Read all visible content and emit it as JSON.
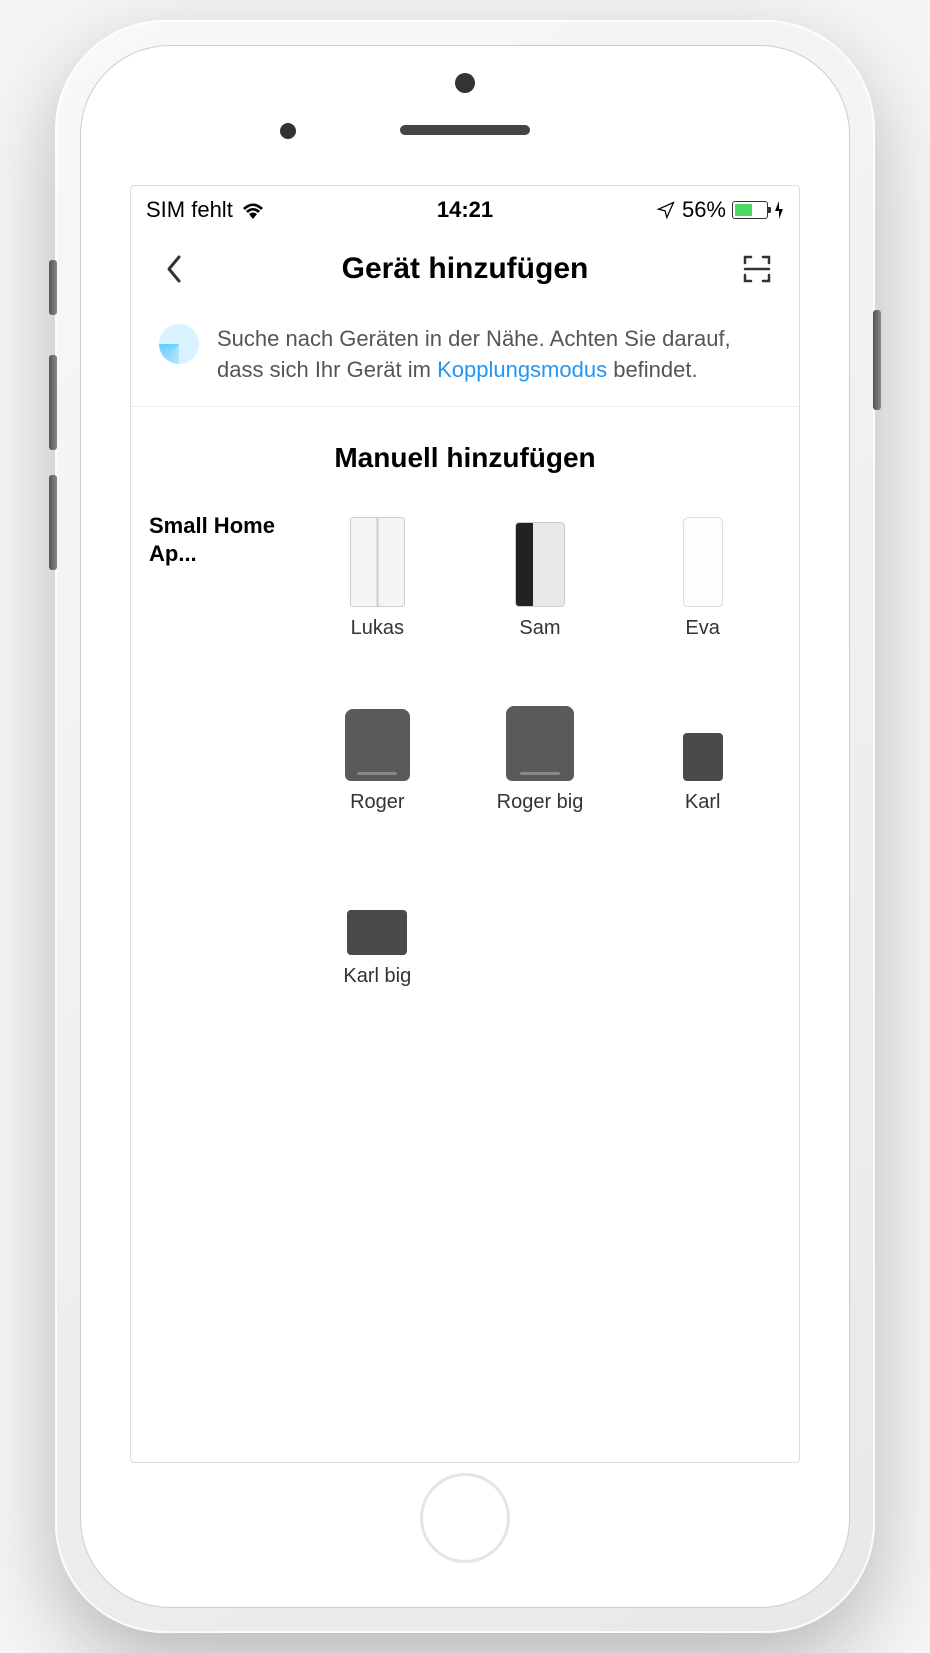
{
  "statusBar": {
    "carrier": "SIM fehlt",
    "time": "14:21",
    "batteryPercent": "56%"
  },
  "header": {
    "title": "Gerät hinzufügen"
  },
  "searchInfo": {
    "textBefore": "Suche nach Geräten in der Nähe. Achten Sie darauf, dass sich Ihr Gerät im ",
    "linkText": "Kopplungsmodus",
    "textAfter": " befindet."
  },
  "sectionHeading": "Manuell hinzufügen",
  "sidebar": {
    "category": "Small Home Ap..."
  },
  "devices": [
    {
      "name": "Lukas",
      "shape": "dev-lukas"
    },
    {
      "name": "Sam",
      "shape": "dev-sam"
    },
    {
      "name": "Eva",
      "shape": "dev-eva"
    },
    {
      "name": "Roger",
      "shape": "dev-roger"
    },
    {
      "name": "Roger big",
      "shape": "dev-roger-big"
    },
    {
      "name": "Karl",
      "shape": "dev-karl"
    },
    {
      "name": "Karl big",
      "shape": "dev-karl-big"
    }
  ]
}
